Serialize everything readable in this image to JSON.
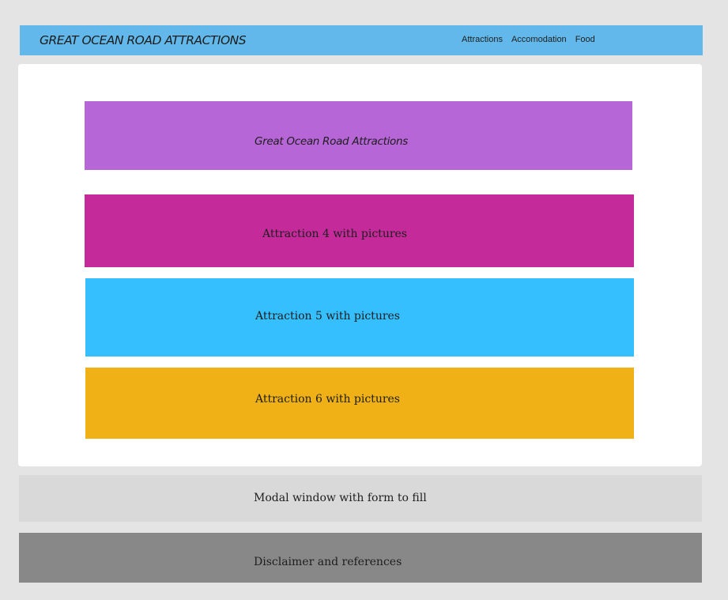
{
  "header": {
    "title": "GREAT OCEAN ROAD ATTRACTIONS",
    "nav": [
      "Attractions",
      "Accomodation",
      "Food"
    ]
  },
  "main": {
    "banner": "Great Ocean Road Attractions",
    "attractions": [
      "Attraction 4 with pictures",
      "Attraction 5 with pictures",
      "Attraction 6 with pictures"
    ]
  },
  "modal": {
    "label": "Modal window with form to fill"
  },
  "footer": {
    "label": "Disclaimer and references"
  },
  "colors": {
    "header": "#62b8ea",
    "banner": "#b666d6",
    "attraction_4": "#c52a9a",
    "attraction_5": "#36bfff",
    "attraction_6": "#efb116",
    "modal": "#d9d9d9",
    "footer": "#888888"
  }
}
